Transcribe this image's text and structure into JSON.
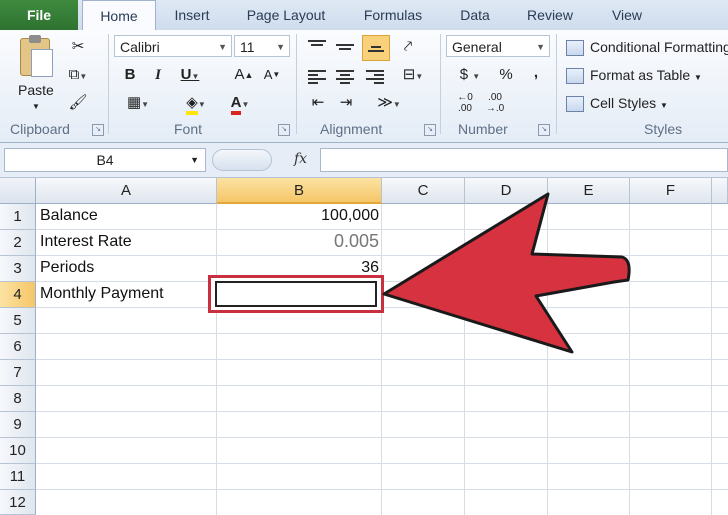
{
  "tabs": [
    "File",
    "Home",
    "Insert",
    "Page Layout",
    "Formulas",
    "Data",
    "Review",
    "View"
  ],
  "clipboard": {
    "paste_label": "Paste",
    "group_label": "Clipboard"
  },
  "font": {
    "name": "Calibri",
    "size": "11",
    "group_label": "Font"
  },
  "alignment": {
    "group_label": "Alignment"
  },
  "number": {
    "format": "General",
    "currency": "$",
    "percent": "%",
    "comma": ",",
    "group_label": "Number"
  },
  "styles": {
    "conditional": "Conditional Formatting",
    "format_table": "Format as Table",
    "cell_styles": "Cell Styles",
    "group_label": "Styles"
  },
  "formula_bar": {
    "name_box": "B4",
    "fx": "fx",
    "value": ""
  },
  "columns": [
    "A",
    "B",
    "C",
    "D",
    "E",
    "F"
  ],
  "active_column": "B",
  "rows": [
    "1",
    "2",
    "3",
    "4",
    "5",
    "6",
    "7",
    "8",
    "9",
    "10",
    "11",
    "12"
  ],
  "active_row": "4",
  "cells": {
    "a1": "Balance",
    "b1": "100,000",
    "a2": "Interest Rate",
    "b2": "0.005",
    "a3": "Periods",
    "b3": "36",
    "a4": "Monthly Payment",
    "b4": ""
  },
  "colors": {
    "file_tab": "#2e7331",
    "annotation": "#d6323f",
    "selection": "#f6c668"
  }
}
